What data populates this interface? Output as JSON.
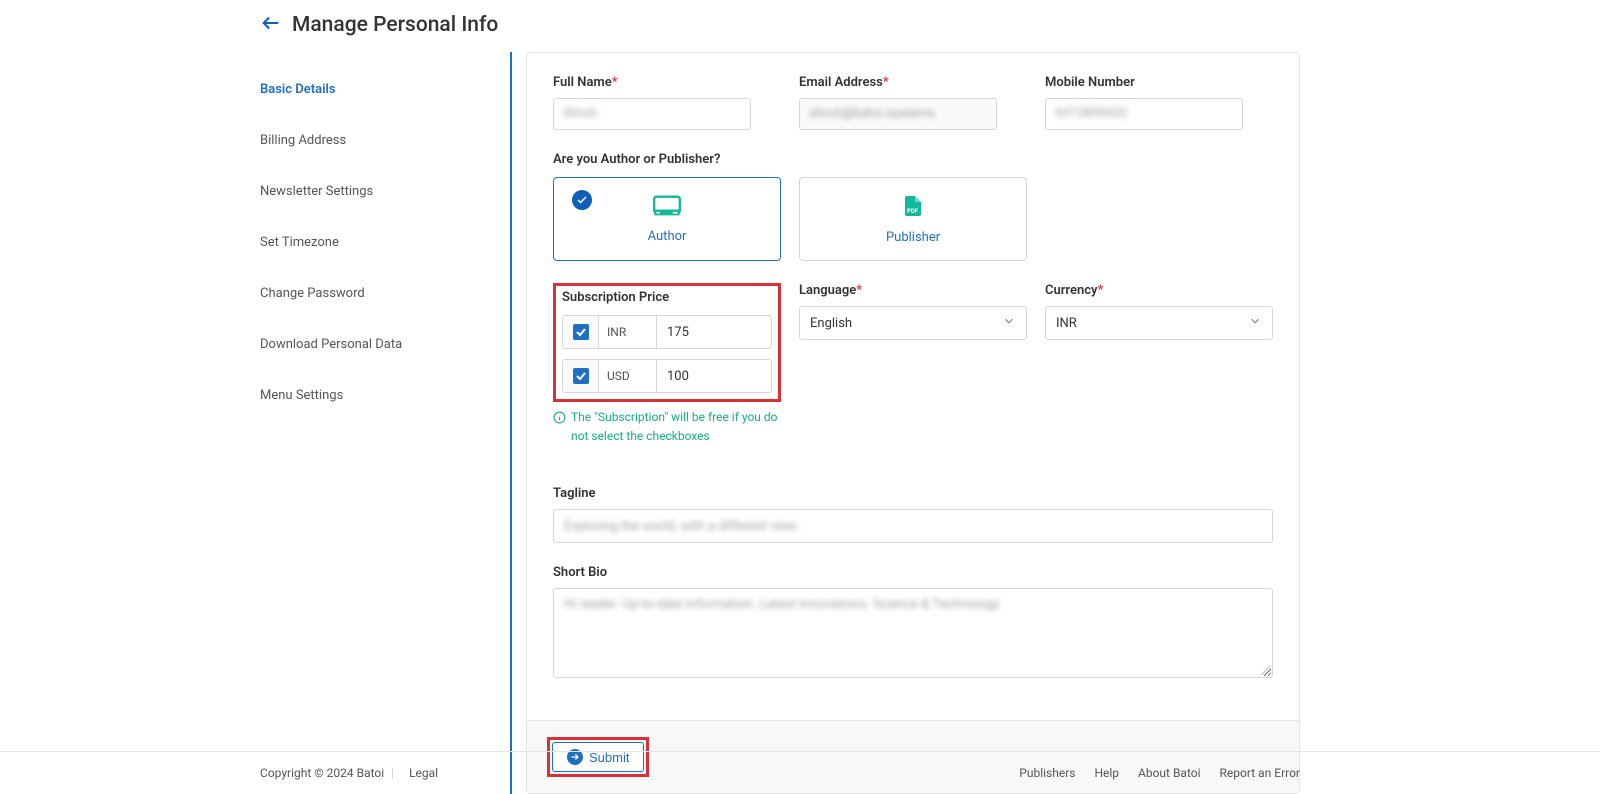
{
  "header": {
    "title": "Manage Personal Info"
  },
  "sidebar": {
    "items": [
      {
        "label": "Basic Details",
        "active": true
      },
      {
        "label": "Billing Address"
      },
      {
        "label": "Newsletter Settings"
      },
      {
        "label": "Set Timezone"
      },
      {
        "label": "Change Password"
      },
      {
        "label": "Download Personal Data"
      },
      {
        "label": "Menu Settings"
      }
    ]
  },
  "form": {
    "full_name_label": "Full Name",
    "email_label": "Email Address",
    "mobile_label": "Mobile Number",
    "role_question": "Are you Author or Publisher?",
    "role_author": "Author",
    "role_publisher": "Publisher",
    "sub_label": "Subscription Price",
    "prices": [
      {
        "currency": "INR",
        "value": "175"
      },
      {
        "currency": "USD",
        "value": "100"
      }
    ],
    "sub_hint": "The \"Subscription\" will be free if you do not select the checkboxes",
    "language_label": "Language",
    "language_value": "English",
    "currency_label": "Currency",
    "currency_value": "INR",
    "tagline_label": "Tagline",
    "bio_label": "Short Bio",
    "submit": "Submit"
  },
  "footer": {
    "copyright": "Copyright © 2024 Batoi",
    "legal": "Legal",
    "links": [
      "Publishers",
      "Help",
      "About Batoi",
      "Report an Error"
    ]
  }
}
